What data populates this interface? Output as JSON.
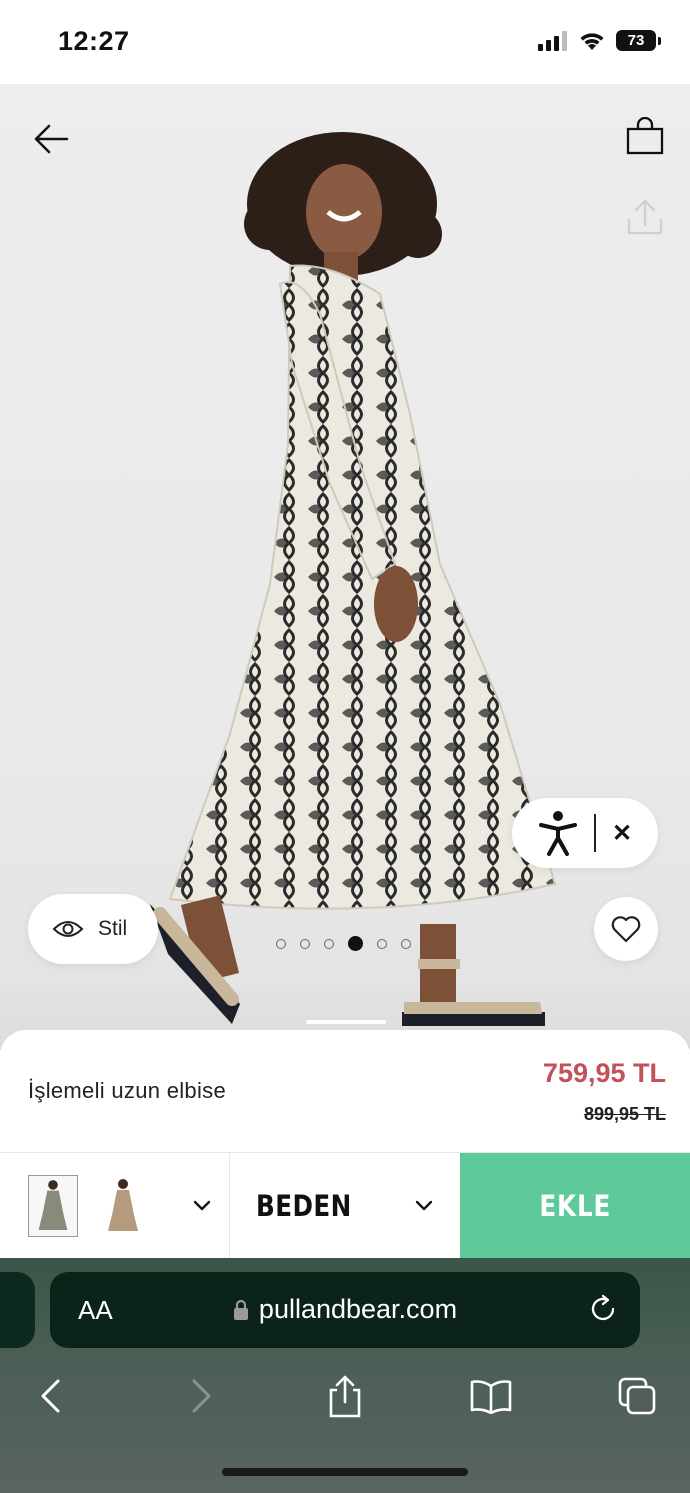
{
  "status_bar": {
    "time": "12:27",
    "battery": "73"
  },
  "hero": {
    "stil_label": "Stil",
    "gallery_dots": 6,
    "active_dot": 3
  },
  "product": {
    "name": "İşlemeli uzun elbise",
    "price": "759,95 TL",
    "old_price": "899,95 TL"
  },
  "actions": {
    "size_label": "BEDEN",
    "add_label": "EKLE"
  },
  "browser": {
    "text_size_label": "AA",
    "url": "pullandbear.com"
  },
  "colors": {
    "price_sale": "#c4505a",
    "add_button": "#5ec99b",
    "browser_bar": "#0b2318"
  }
}
